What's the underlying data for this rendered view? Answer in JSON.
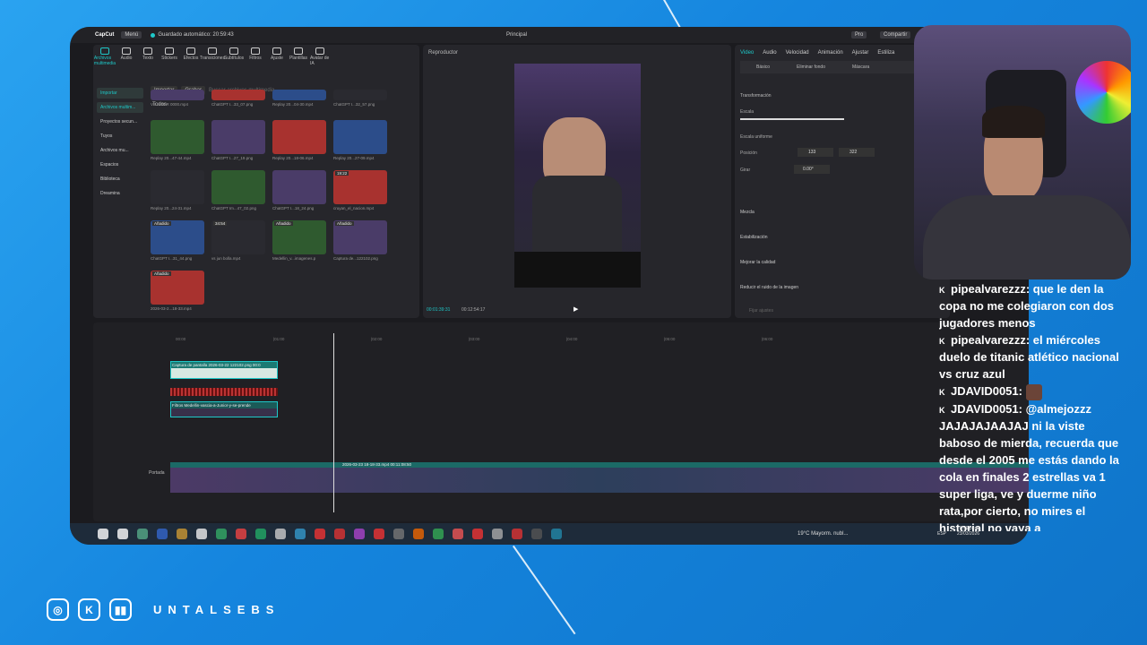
{
  "app": {
    "name": "CapCut",
    "menu_label": "Menú",
    "autosave": "Guardado automático: 20:59:43",
    "project_title": "Principal",
    "pro_label": "Pro",
    "share_label": "Compartir"
  },
  "toolbar": [
    {
      "label": "Archivos multimedia",
      "icon": "media-icon"
    },
    {
      "label": "Audio",
      "icon": "audio-icon"
    },
    {
      "label": "Texto",
      "icon": "text-icon"
    },
    {
      "label": "Stickers",
      "icon": "sticker-icon"
    },
    {
      "label": "Efectos",
      "icon": "effects-icon"
    },
    {
      "label": "Transiciones",
      "icon": "transitions-icon"
    },
    {
      "label": "Subtítulos",
      "icon": "subtitles-icon"
    },
    {
      "label": "Filtros",
      "icon": "filters-icon"
    },
    {
      "label": "Ajuste",
      "icon": "adjust-icon"
    },
    {
      "label": "Plantillas",
      "icon": "templates-icon"
    },
    {
      "label": "Avatar de IA",
      "icon": "avatar-icon"
    }
  ],
  "sidebar": [
    "Importar",
    "Archivos multim...",
    "Proyectos secun...",
    "Tuyos",
    "Archivos mu...",
    "Espacios",
    "Biblioteca",
    "Dreamina"
  ],
  "media": {
    "import_btn": "Importar",
    "record_btn": "Grabar",
    "search_placeholder": "Buscar archivos multimedia",
    "all_label": "Todos",
    "items": [
      {
        "name": "VS INTER 0000.mp4",
        "badge": ""
      },
      {
        "name": "ChatGPT I...33_07.png",
        "badge": ""
      },
      {
        "name": "Replay 20...04-30.mp4",
        "badge": ""
      },
      {
        "name": "ChatGPT I...32_57.png",
        "badge": ""
      },
      {
        "name": "Replay 20...47-44.mp4",
        "badge": ""
      },
      {
        "name": "ChatGPT I...27_19.png",
        "badge": ""
      },
      {
        "name": "Replay 20...18-06.mp4",
        "badge": ""
      },
      {
        "name": "Replay 20...27-09.mp4",
        "badge": ""
      },
      {
        "name": "Replay 20...24-31.mp4",
        "badge": ""
      },
      {
        "name": "ChatGPT Im...47_02.png",
        "badge": ""
      },
      {
        "name": "ChatGPT I...18_24.png",
        "badge": ""
      },
      {
        "name": "cruyan_el_nacion.mp4",
        "badge": "19:22"
      },
      {
        "name": "ChatGPT I...31_44.png",
        "badge": "Añadido"
      },
      {
        "name": "vs jun bolla.mp4",
        "badge": "34:54"
      },
      {
        "name": "Medellin_v...imagenes.p",
        "badge": "Añadido"
      },
      {
        "name": "Captura de...122102.png",
        "badge": "Añadido"
      },
      {
        "name": "2026-03-2...18-33.mp4",
        "badge": "Añadido"
      }
    ]
  },
  "player": {
    "title": "Reproductor",
    "current_time": "00:01:39:31",
    "total_time": "00:12:54:17"
  },
  "inspector": {
    "tabs": [
      "Video",
      "Audio",
      "Velocidad",
      "Animación",
      "Ajustar",
      "Estiliza"
    ],
    "subtabs": [
      "Básico",
      "Eliminar fondo",
      "Máscara"
    ],
    "section_transform": "Transformación",
    "scale_label": "Escala",
    "uniform_scale": "Escala uniforme",
    "position_label": "Posición",
    "pos_x": "133",
    "pos_y": "322",
    "rotate_label": "Girar",
    "rotate_value": "0.00°",
    "blend_label": "Mezcla",
    "stabilize_label": "Estabilización",
    "quality_label": "Mejorar la calidad",
    "noise_label": "Reducir el ruido de la imagen",
    "save_preset": "Fijar ajustes"
  },
  "timeline": {
    "ruler": [
      "00:00",
      "|01:00",
      "|02:00",
      "|03:00",
      "|04:00",
      "|05:00",
      "|06:00"
    ],
    "clip1": "Captura de pantalla 2026-03-22 122102.png  00:0",
    "clip2": "Filtros  Medellin-vascia-a-Junior-y-se-prende",
    "main_clip": "2026-03-23 18-18-33.mp4  00:11:08:50",
    "cover_label": "Portada"
  },
  "taskbar": {
    "weather": "19°C  Mayorm. nubl...",
    "lang": "ESP",
    "time": "8:59 p. m.",
    "date": "23/03/2026"
  },
  "chat": [
    {
      "user": "pipealvarezzz",
      "msg": "que le den la copa no me colegiaron con dos jugadores menos"
    },
    {
      "user": "pipealvarezzz",
      "msg": "el miércoles duelo de titanic atlético nacional vs cruz azul"
    },
    {
      "user": "JDAVID0051",
      "msg": ""
    },
    {
      "user": "JDAVID0051",
      "msg": "@almejozzz JAJAJAJAAJAJ ni la viste baboso de mierda, recuerda que desde el 2005 me estás dando la cola en finales 2 estrellas va 1 super liga, ve y duerme niño rata,por cierto, no mires el historial no vaya a"
    }
  ],
  "branding": {
    "handle": "UNTALSEBS"
  },
  "colors": {
    "accent": "#1ec8c8",
    "bg": "#1585de"
  }
}
